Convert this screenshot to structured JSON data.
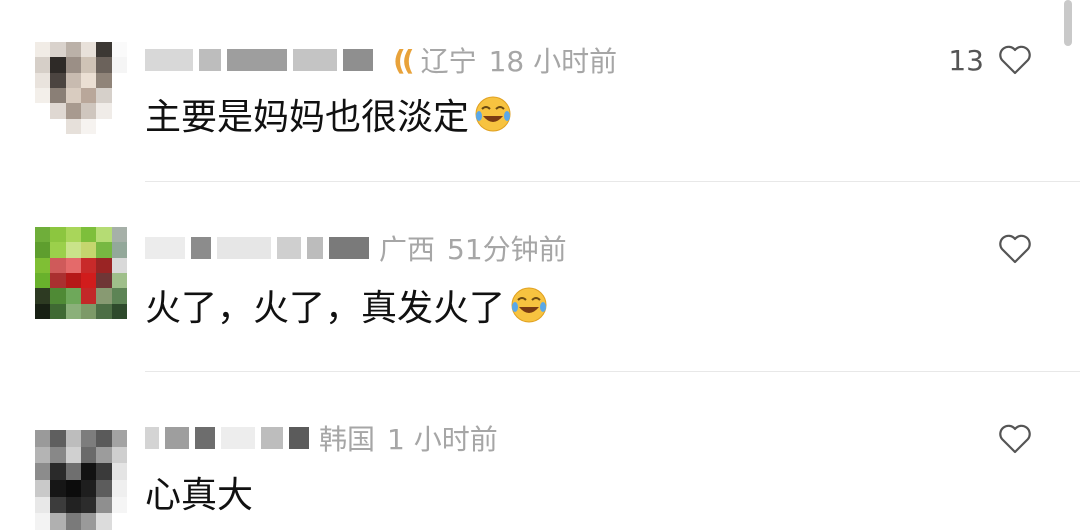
{
  "comments": [
    {
      "location": "辽宁",
      "time": "18 小时前",
      "text": "主要是妈妈也很淡定",
      "emoji_icon": "rolling-on-floor-laughing-icon",
      "like_count": "13"
    },
    {
      "location": "广西",
      "time": "51分钟前",
      "text": "火了，火了，真发火了",
      "emoji_icon": "rolling-on-floor-laughing-icon",
      "like_count": ""
    },
    {
      "location": "韩国",
      "time": "1 小时前",
      "text": "心真大",
      "emoji_icon": "",
      "like_count": ""
    }
  ],
  "colors": {
    "text": "#111111",
    "meta": "#a6a6a6",
    "badge": "#e8a23a",
    "divider": "#e8e8e8"
  }
}
